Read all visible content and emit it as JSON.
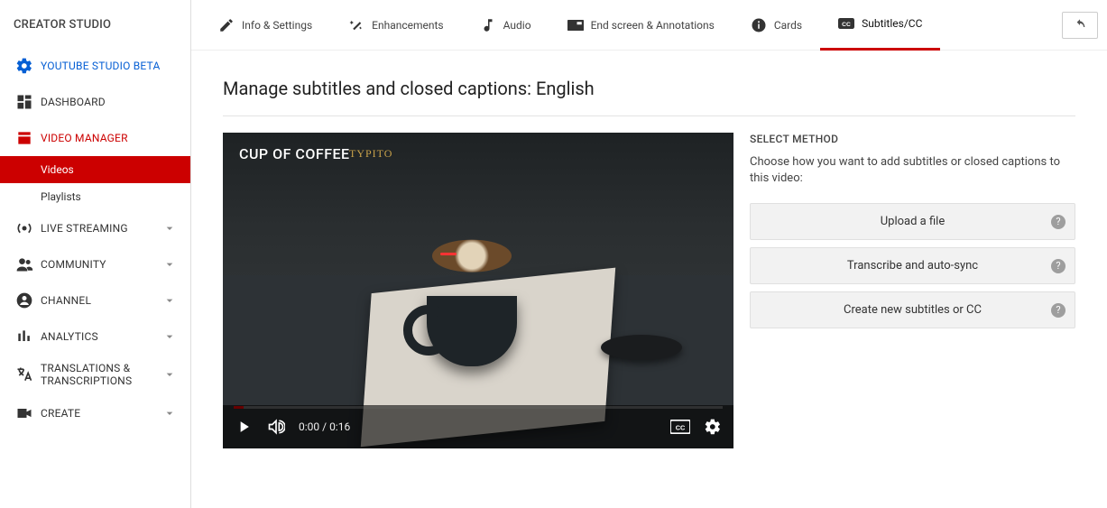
{
  "sidebar": {
    "title": "CREATOR STUDIO",
    "items": [
      {
        "label": "YOUTUBE STUDIO BETA",
        "kind": "link-blue",
        "icon": "gear"
      },
      {
        "label": "DASHBOARD",
        "icon": "dashboard"
      },
      {
        "label": "VIDEO MANAGER",
        "kind": "link-red",
        "icon": "film",
        "sub": [
          {
            "label": "Videos",
            "active": true
          },
          {
            "label": "Playlists"
          }
        ]
      },
      {
        "label": "LIVE STREAMING",
        "icon": "broadcast",
        "expandable": true
      },
      {
        "label": "COMMUNITY",
        "icon": "people",
        "expandable": true
      },
      {
        "label": "CHANNEL",
        "icon": "account",
        "expandable": true
      },
      {
        "label": "ANALYTICS",
        "icon": "stats",
        "expandable": true
      },
      {
        "label": "TRANSLATIONS & TRANSCRIPTIONS",
        "icon": "translate",
        "expandable": true
      },
      {
        "label": "CREATE",
        "icon": "camera",
        "expandable": true
      }
    ]
  },
  "tabs": [
    {
      "label": "Info & Settings",
      "icon": "pencil"
    },
    {
      "label": "Enhancements",
      "icon": "wand"
    },
    {
      "label": "Audio",
      "icon": "note"
    },
    {
      "label": "End screen & Annotations",
      "icon": "endscreen"
    },
    {
      "label": "Cards",
      "icon": "info"
    },
    {
      "label": "Subtitles/CC",
      "icon": "cc",
      "active": true
    }
  ],
  "page": {
    "title": "Manage subtitles and closed captions: English"
  },
  "video": {
    "overlay_title": "CUP OF COFFEE",
    "watermark": "TYPITO",
    "current_time": "0:00",
    "duration": "0:16"
  },
  "method": {
    "title": "SELECT METHOD",
    "description": "Choose how you want to add subtitles or closed captions to this video:",
    "options": [
      {
        "label": "Upload a file"
      },
      {
        "label": "Transcribe and auto-sync"
      },
      {
        "label": "Create new subtitles or CC"
      }
    ]
  }
}
